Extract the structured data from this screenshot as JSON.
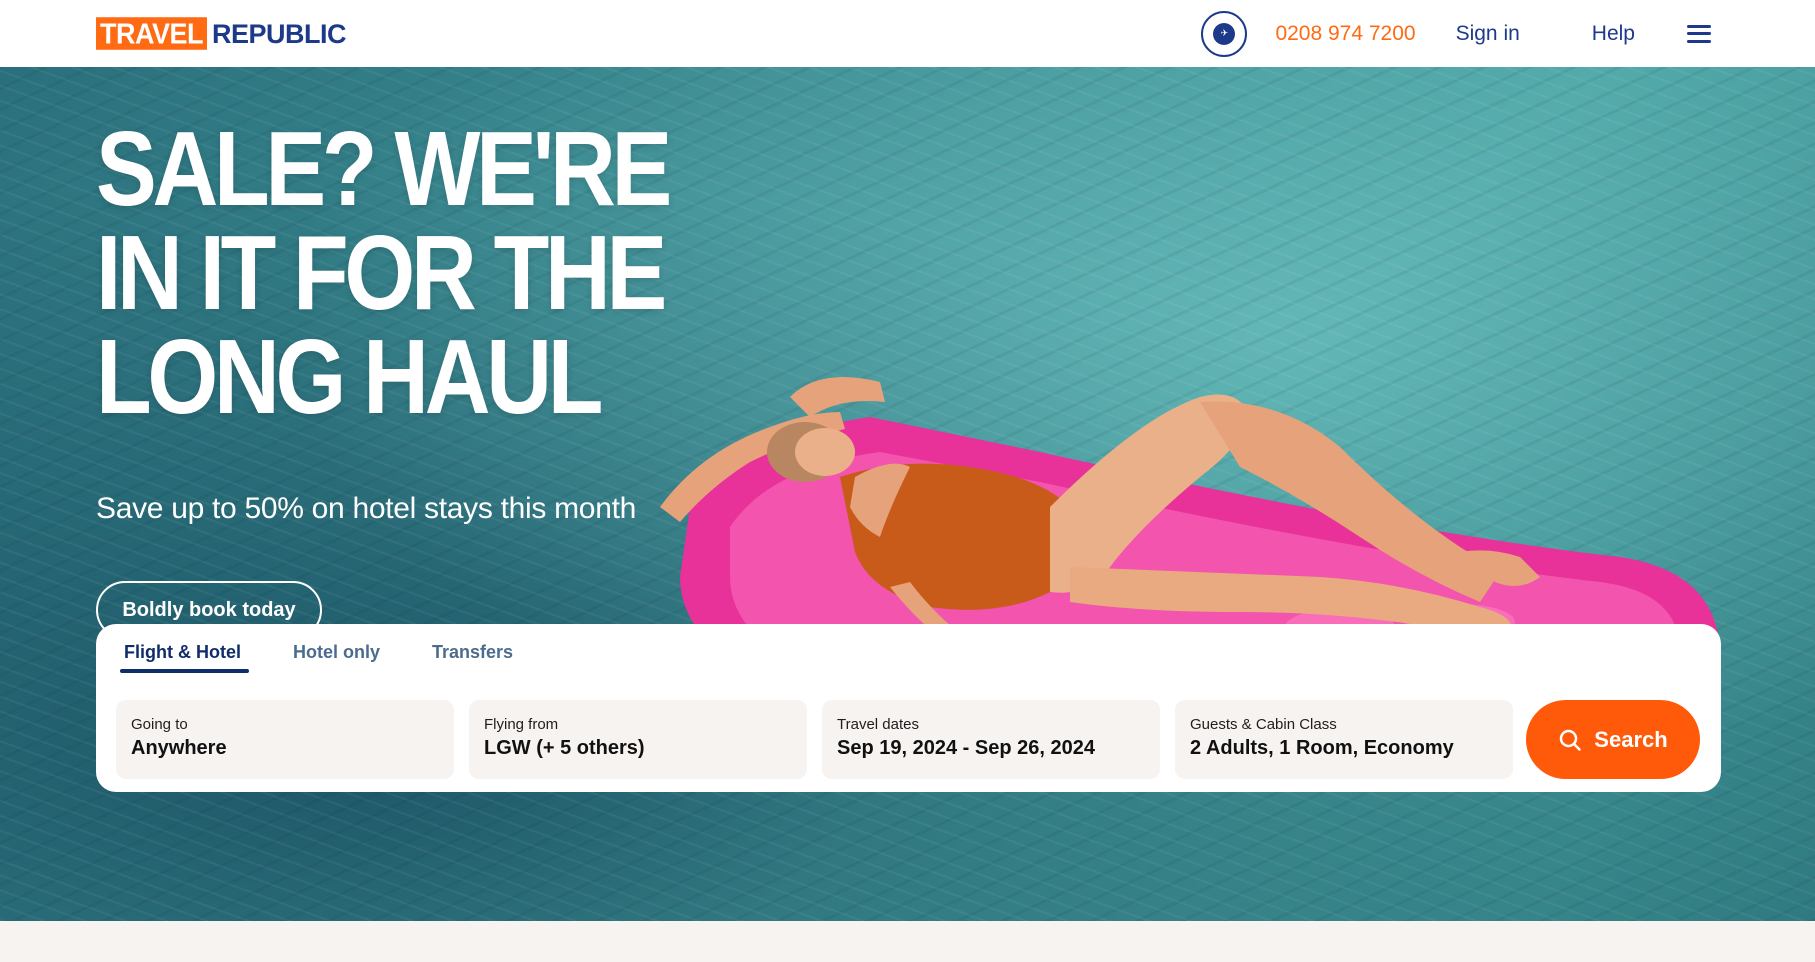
{
  "header": {
    "logo_part1": "TRAVEL",
    "logo_part2": "REPUBLIC",
    "phone": "0208 974 7200",
    "sign_in": "Sign in",
    "help": "Help",
    "badge_icon": "atol-protected-badge-icon",
    "menu_icon": "hamburger-menu-icon"
  },
  "hero": {
    "headline": "SALE? WE'RE IN IT FOR THE LONG HAUL",
    "subline": "Save up to 50% on hotel stays this month",
    "cta_label": "Boldly book today"
  },
  "search": {
    "tabs": [
      {
        "label": "Flight & Hotel",
        "active": true
      },
      {
        "label": "Hotel only",
        "active": false
      },
      {
        "label": "Transfers",
        "active": false
      }
    ],
    "fields": [
      {
        "label": "Going to",
        "value": "Anywhere"
      },
      {
        "label": "Flying from",
        "value": "LGW (+ 5 others)"
      },
      {
        "label": "Travel dates",
        "value": "Sep 19, 2024 - Sep 26, 2024"
      },
      {
        "label": "Guests & Cabin Class",
        "value": "2 Adults, 1 Room, Economy"
      }
    ],
    "button_label": "Search",
    "button_icon": "search-icon"
  },
  "colors": {
    "brand_orange": "#ff6a13",
    "brand_navy": "#1d3a8a",
    "search_button": "#ff5a0a"
  }
}
